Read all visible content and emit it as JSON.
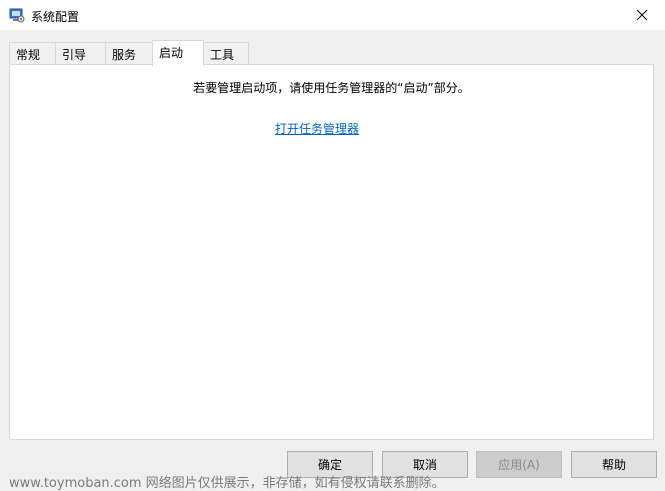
{
  "window": {
    "title": "系统配置",
    "icon": "msconfig-icon",
    "close_glyph": "✕"
  },
  "tabs": [
    {
      "label": "常规",
      "active": false
    },
    {
      "label": "引导",
      "active": false
    },
    {
      "label": "服务",
      "active": false
    },
    {
      "label": "启动",
      "active": true
    },
    {
      "label": "工具",
      "active": false
    }
  ],
  "panel": {
    "info_text": "若要管理启动项，请使用任务管理器的“启动”部分。",
    "link_text": "打开任务管理器"
  },
  "buttons": {
    "ok": "确定",
    "cancel": "取消",
    "apply": "应用(A)",
    "help": "帮助"
  },
  "watermark": "www.toymoban.com 网络图片仅供展示，非存储，如有侵权请联系删除。"
}
